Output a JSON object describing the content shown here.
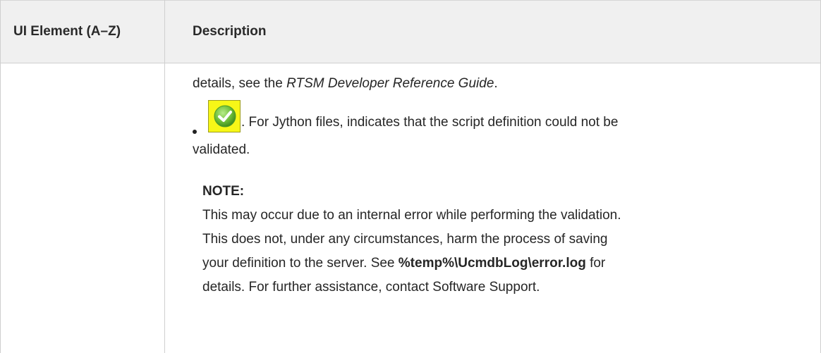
{
  "table": {
    "headers": {
      "col1": "UI Element (A–Z)",
      "col2": "Description"
    },
    "row": {
      "line1_prefix": "details, see the ",
      "line1_italic": "RTSM Developer Reference Guide",
      "line1_suffix": ".",
      "bullet": {
        "icon": "check-circle-icon",
        "text_line1": ". For Jython files, indicates that the script definition could not be",
        "text_line2": "validated."
      },
      "note": {
        "heading": "NOTE:",
        "line1": "This may occur due to an internal error while performing the validation.",
        "line2": "This does not, under any circumstances, harm the process of saving",
        "line3_prefix": "your definition to the server. See ",
        "line3_bold": "%temp%\\UcmdbLog\\error.log",
        "line3_suffix": " for",
        "line4": "details. For further assistance, contact Software Support."
      }
    }
  },
  "colors": {
    "header_bg": "#f0f0f0",
    "icon_bg": "#f7f717",
    "check_green": "#6fbf3a"
  }
}
